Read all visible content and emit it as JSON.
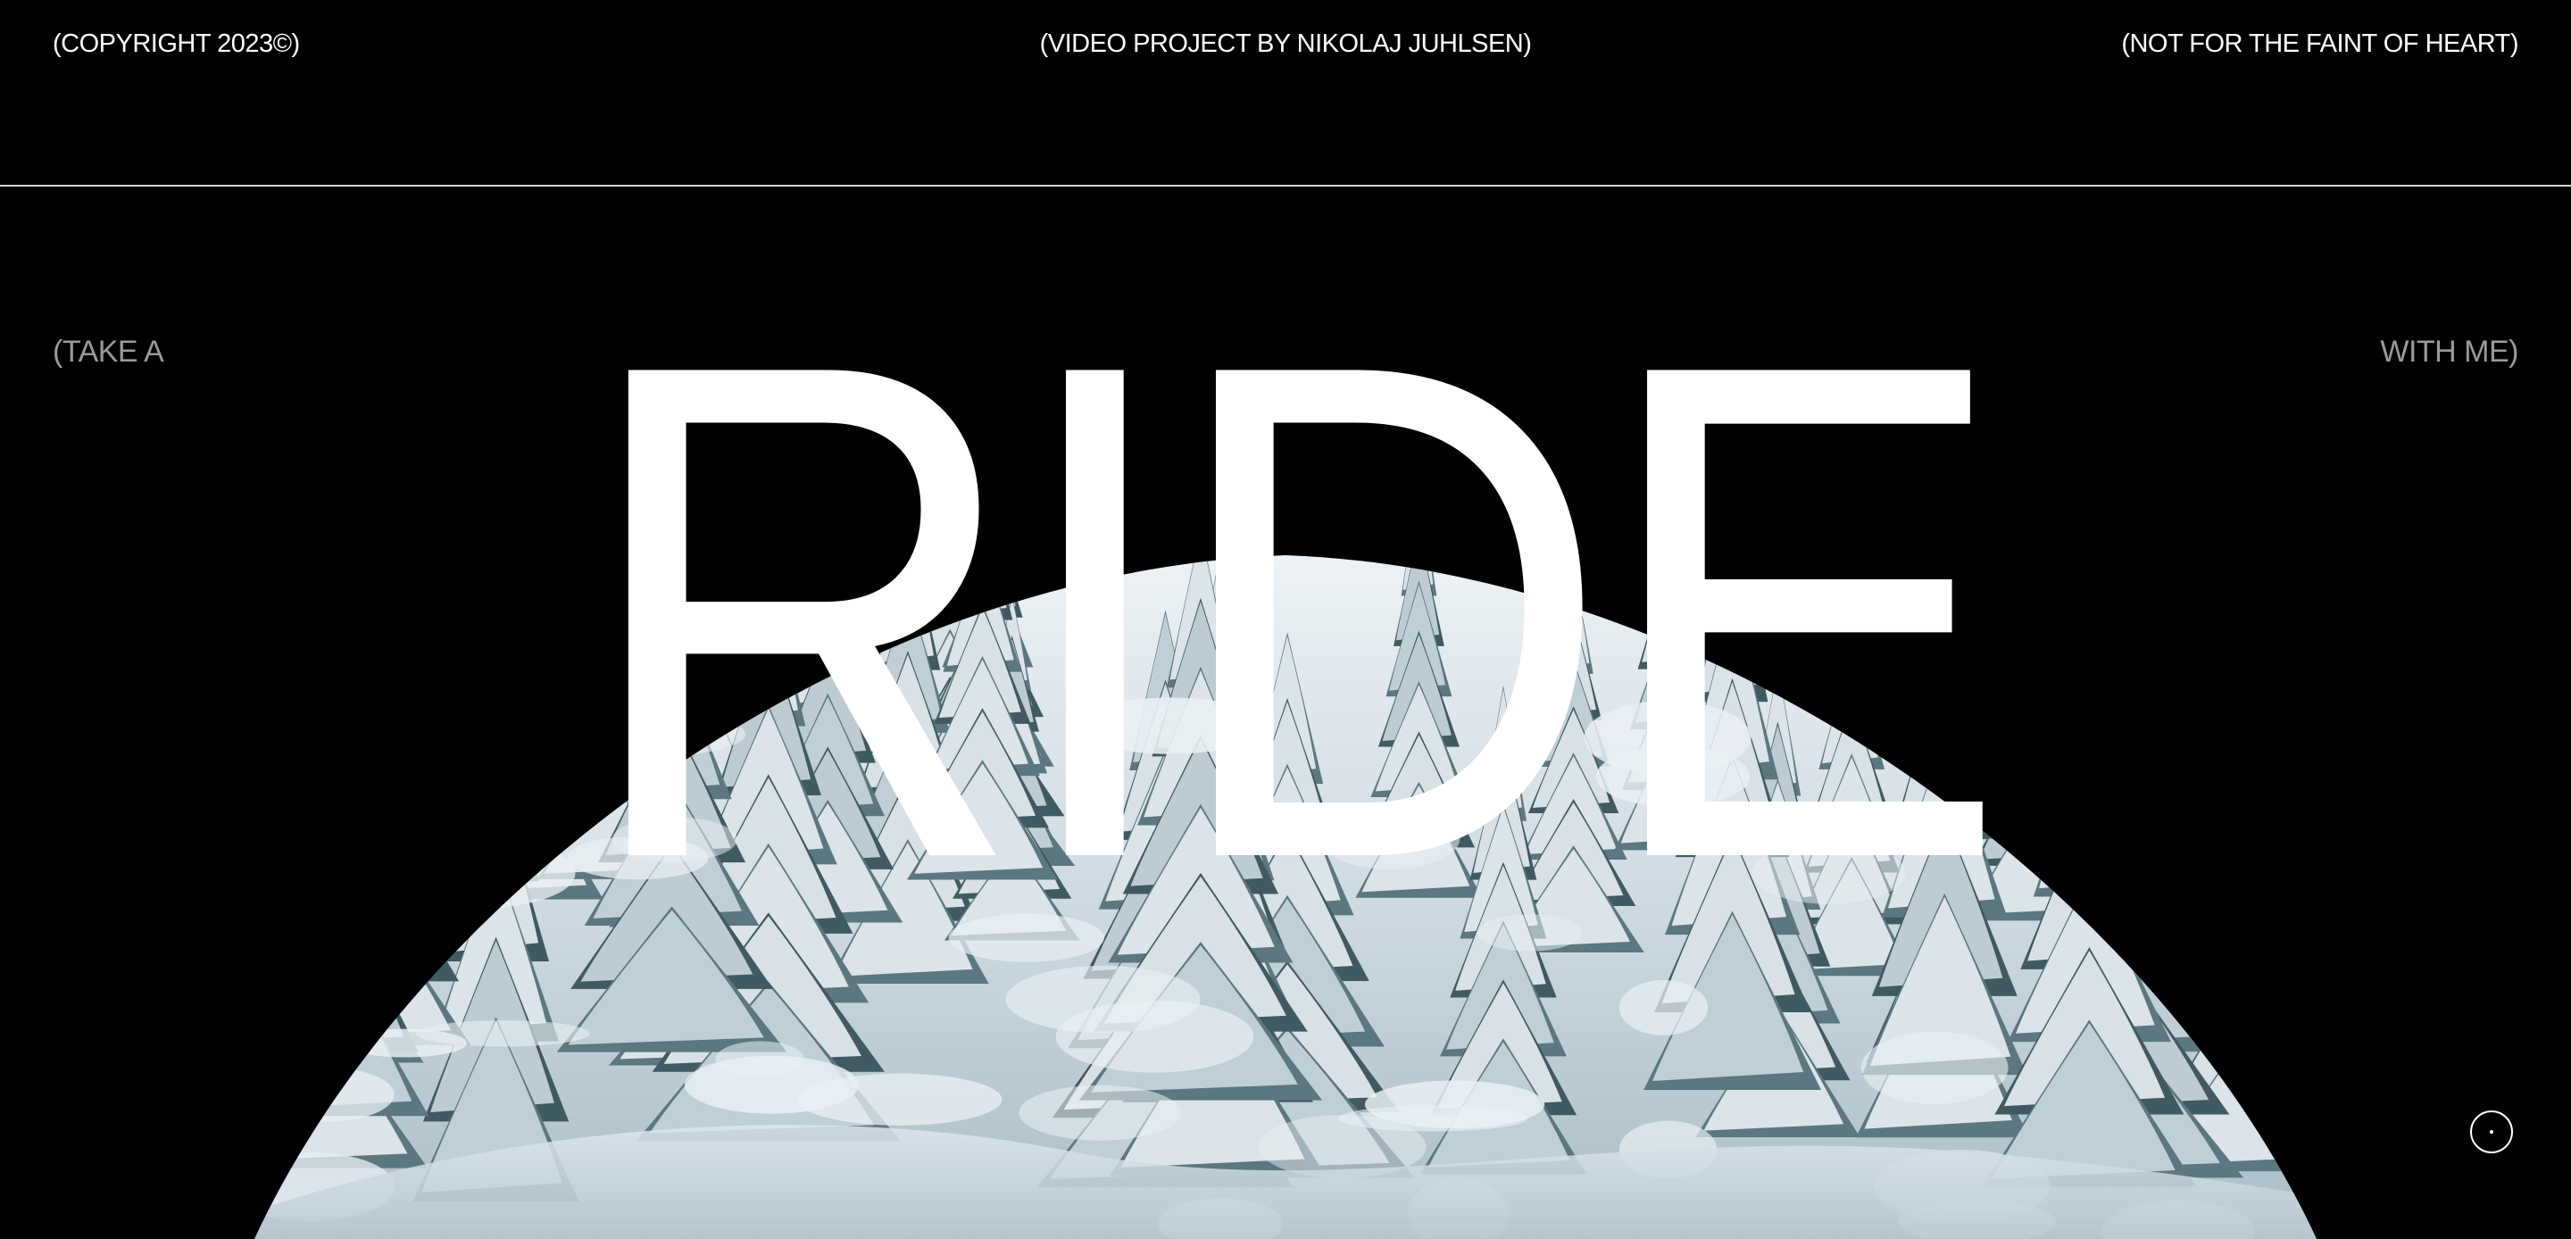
{
  "header": {
    "copyright": "(COPYRIGHT 2023©)",
    "credit": "(VIDEO PROJECT BY NIKOLAJ JUHLSEN)",
    "warning": "(NOT FOR THE FAINT OF HEART)"
  },
  "hero": {
    "left_caption": "(TAKE A",
    "title": "RIDE",
    "right_caption": "WITH ME)"
  },
  "video": {
    "scene": "snow-covered pine forest"
  },
  "colors": {
    "background": "#000000",
    "text": "#ffffff",
    "caption": "#9a9a9a",
    "snow": "#dfe8ee",
    "pine": "#4f6a70"
  },
  "icons": {
    "scroll_indicator": "scroll-indicator-icon"
  }
}
